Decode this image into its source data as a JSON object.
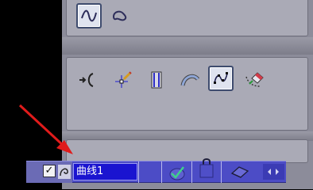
{
  "layer_row": {
    "name": "曲线1",
    "visible_check": "✓",
    "highlight_color": "#1a14d0"
  },
  "top_toolbar": {
    "buttons": [
      {
        "icon": "spline-curve-icon",
        "pressed": true
      },
      {
        "icon": "closed-curve-icon",
        "pressed": false
      }
    ]
  },
  "middle_toolbar": {
    "buttons": [
      {
        "icon": "curve-tangent-point-icon",
        "pressed": false
      },
      {
        "icon": "point-on-curve-icon",
        "pressed": false
      },
      {
        "icon": "parallel-lines-icon",
        "pressed": false
      },
      {
        "icon": "arc-icon",
        "pressed": false
      },
      {
        "icon": "curve-edit-icon",
        "pressed": true
      },
      {
        "icon": "curve-eraser-icon",
        "pressed": false
      }
    ]
  },
  "annotation": {
    "color": "#e01b1b"
  }
}
